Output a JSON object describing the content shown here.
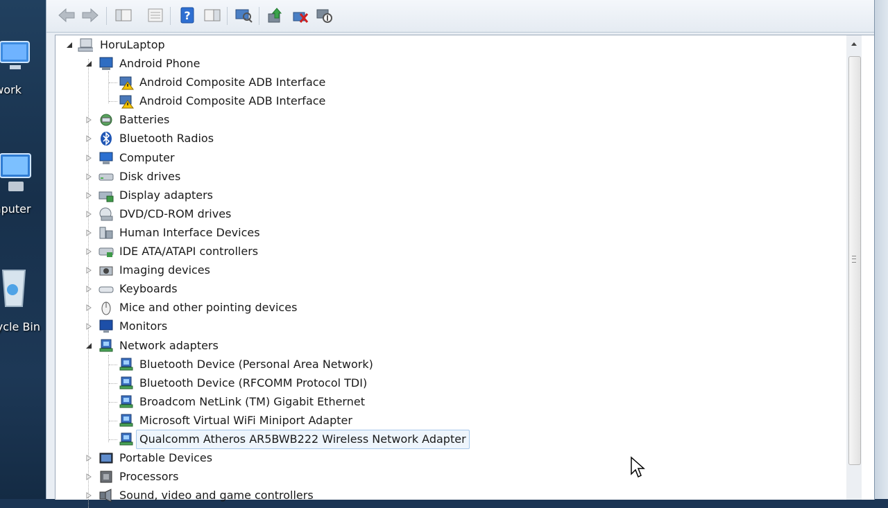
{
  "desktop": {
    "icons": [
      {
        "label": "twork",
        "icon": "network-icon"
      },
      {
        "label": "mputer",
        "icon": "computer-icon"
      },
      {
        "label": "cycle Bin",
        "icon": "recycle-bin-icon"
      }
    ]
  },
  "toolbar": {
    "buttons": [
      "back-arrow-icon",
      "forward-arrow-icon",
      "show-hide-tree-icon",
      "properties-icon",
      "help-icon",
      "action-pane-icon",
      "scan-hardware-icon",
      "update-driver-icon",
      "uninstall-icon",
      "disable-device-icon"
    ]
  },
  "tree": {
    "root": "HoruLaptop",
    "items": [
      {
        "label": "Android Phone",
        "icon": "android-phone-icon",
        "level": 1,
        "expanded": true
      },
      {
        "label": "Android Composite ADB Interface",
        "icon": "warning-device-icon",
        "level": 2
      },
      {
        "label": "Android Composite ADB Interface",
        "icon": "warning-device-icon",
        "level": 2
      },
      {
        "label": "Batteries",
        "icon": "battery-icon",
        "level": 1
      },
      {
        "label": "Bluetooth Radios",
        "icon": "bluetooth-icon",
        "level": 1
      },
      {
        "label": "Computer",
        "icon": "computer-icon",
        "level": 1
      },
      {
        "label": "Disk drives",
        "icon": "disk-drive-icon",
        "level": 1
      },
      {
        "label": "Display adapters",
        "icon": "display-adapter-icon",
        "level": 1
      },
      {
        "label": "DVD/CD-ROM drives",
        "icon": "dvd-drive-icon",
        "level": 1
      },
      {
        "label": "Human Interface Devices",
        "icon": "hid-icon",
        "level": 1
      },
      {
        "label": "IDE ATA/ATAPI controllers",
        "icon": "ide-controller-icon",
        "level": 1
      },
      {
        "label": "Imaging devices",
        "icon": "camera-icon",
        "level": 1
      },
      {
        "label": "Keyboards",
        "icon": "keyboard-icon",
        "level": 1
      },
      {
        "label": "Mice and other pointing devices",
        "icon": "mouse-icon",
        "level": 1
      },
      {
        "label": "Monitors",
        "icon": "monitor-icon",
        "level": 1
      },
      {
        "label": "Network adapters",
        "icon": "network-adapter-icon",
        "level": 1,
        "expanded": true
      },
      {
        "label": "Bluetooth Device (Personal Area Network)",
        "icon": "network-adapter-icon",
        "level": 2
      },
      {
        "label": "Bluetooth Device (RFCOMM Protocol TDI)",
        "icon": "network-adapter-icon",
        "level": 2
      },
      {
        "label": "Broadcom NetLink (TM) Gigabit Ethernet",
        "icon": "network-adapter-icon",
        "level": 2
      },
      {
        "label": "Microsoft Virtual WiFi Miniport Adapter",
        "icon": "network-adapter-icon",
        "level": 2
      },
      {
        "label": "Qualcomm Atheros AR5BWB222 Wireless Network Adapter",
        "icon": "network-adapter-icon",
        "level": 2,
        "selected": true
      },
      {
        "label": "Portable Devices",
        "icon": "portable-device-icon",
        "level": 1
      },
      {
        "label": "Processors",
        "icon": "processor-icon",
        "level": 1
      },
      {
        "label": "Sound, video and game controllers",
        "icon": "sound-icon",
        "level": 1
      }
    ]
  },
  "colors": {
    "selection_bg": "#eef5fc",
    "selection_border": "#a5c7ea",
    "window_bg": "#e9eef4"
  }
}
